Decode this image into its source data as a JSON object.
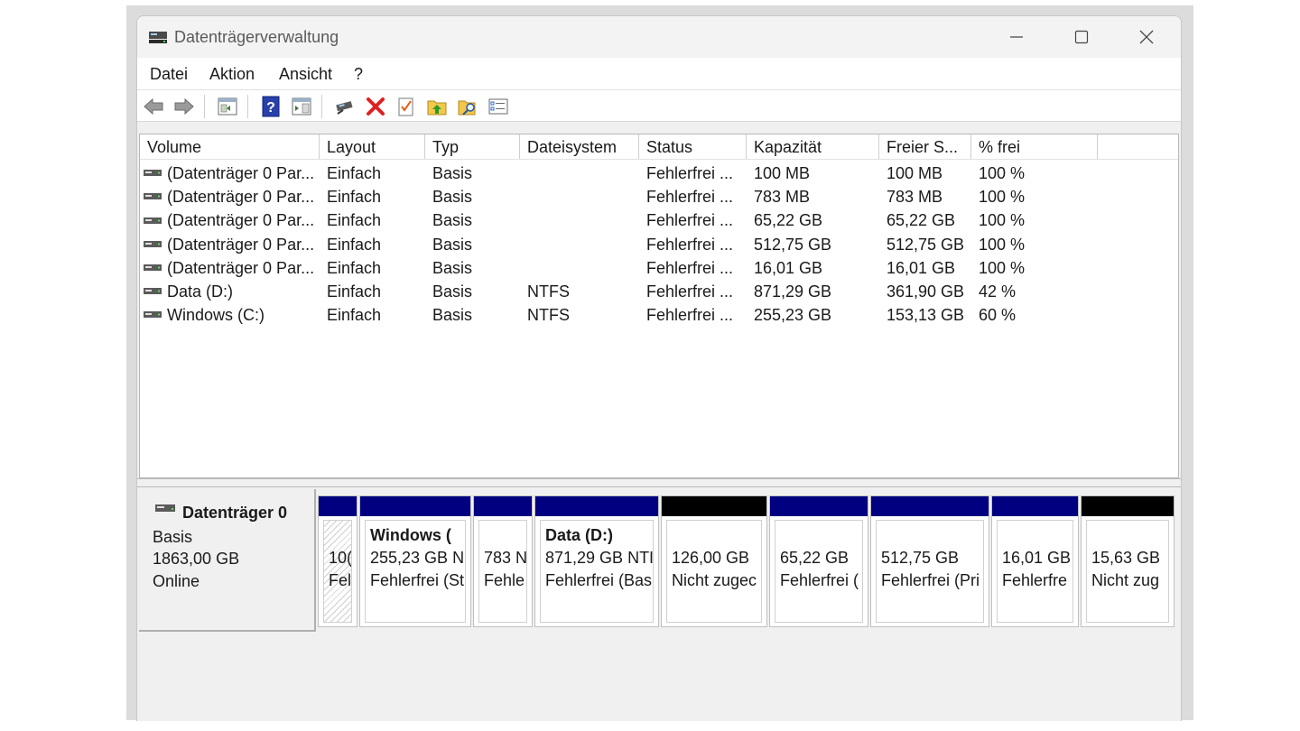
{
  "window": {
    "title": "Datenträgerverwaltung"
  },
  "menu": [
    "Datei",
    "Aktion",
    "Ansicht",
    "?"
  ],
  "toolbar_icons": [
    "back-arrow-icon",
    "forward-arrow-icon",
    "console-tree-icon",
    "help-icon",
    "properties-icon",
    "connect-disk-icon",
    "delete-icon",
    "checklist-icon",
    "folder-up-icon",
    "search-folder-icon",
    "settings-list-icon"
  ],
  "colors": {
    "primary_partition": "#000080",
    "unallocated": "#000000",
    "delete_icon": "#e02020"
  },
  "list": {
    "columns": [
      "Volume",
      "Layout",
      "Typ",
      "Dateisystem",
      "Status",
      "Kapazität",
      "Freier S...",
      "% frei"
    ],
    "rows": [
      [
        "(Datenträger 0 Par...",
        "Einfach",
        "Basis",
        "",
        "Fehlerfrei ...",
        "100 MB",
        "100 MB",
        "100 %"
      ],
      [
        "(Datenträger 0 Par...",
        "Einfach",
        "Basis",
        "",
        "Fehlerfrei ...",
        "783 MB",
        "783 MB",
        "100 %"
      ],
      [
        "(Datenträger 0 Par...",
        "Einfach",
        "Basis",
        "",
        "Fehlerfrei ...",
        "65,22 GB",
        "65,22 GB",
        "100 %"
      ],
      [
        "(Datenträger 0 Par...",
        "Einfach",
        "Basis",
        "",
        "Fehlerfrei ...",
        "512,75 GB",
        "512,75 GB",
        "100 %"
      ],
      [
        "(Datenträger 0 Par...",
        "Einfach",
        "Basis",
        "",
        "Fehlerfrei ...",
        "16,01 GB",
        "16,01 GB",
        "100 %"
      ],
      [
        "Data (D:)",
        "Einfach",
        "Basis",
        "NTFS",
        "Fehlerfrei ...",
        "871,29 GB",
        "361,90 GB",
        "42 %"
      ],
      [
        "Windows (C:)",
        "Einfach",
        "Basis",
        "NTFS",
        "Fehlerfrei ...",
        "255,23 GB",
        "153,13 GB",
        "60 %"
      ]
    ]
  },
  "disk": {
    "name": "Datenträger 0",
    "type": "Basis",
    "size": "1863,00 GB",
    "state": "Online",
    "partitions": [
      {
        "name": "",
        "line1": "10(",
        "line2": "Fel",
        "kind": "primary",
        "selected": true
      },
      {
        "name": "Windows  (",
        "line1": "255,23 GB N",
        "line2": "Fehlerfrei (St",
        "kind": "primary"
      },
      {
        "name": "",
        "line1": "783 N",
        "line2": "Fehle",
        "kind": "primary"
      },
      {
        "name": "Data  (D:)",
        "line1": "871,29 GB NTI",
        "line2": "Fehlerfrei (Bas",
        "kind": "primary"
      },
      {
        "name": "",
        "line1": "126,00 GB",
        "line2": "Nicht zugec",
        "kind": "unallocated"
      },
      {
        "name": "",
        "line1": "65,22 GB",
        "line2": "Fehlerfrei (",
        "kind": "primary"
      },
      {
        "name": "",
        "line1": "512,75 GB",
        "line2": "Fehlerfrei (Pri",
        "kind": "primary"
      },
      {
        "name": "",
        "line1": "16,01 GB",
        "line2": "Fehlerfre",
        "kind": "primary"
      },
      {
        "name": "",
        "line1": "15,63 GB",
        "line2": "Nicht zug",
        "kind": "unallocated"
      }
    ]
  }
}
